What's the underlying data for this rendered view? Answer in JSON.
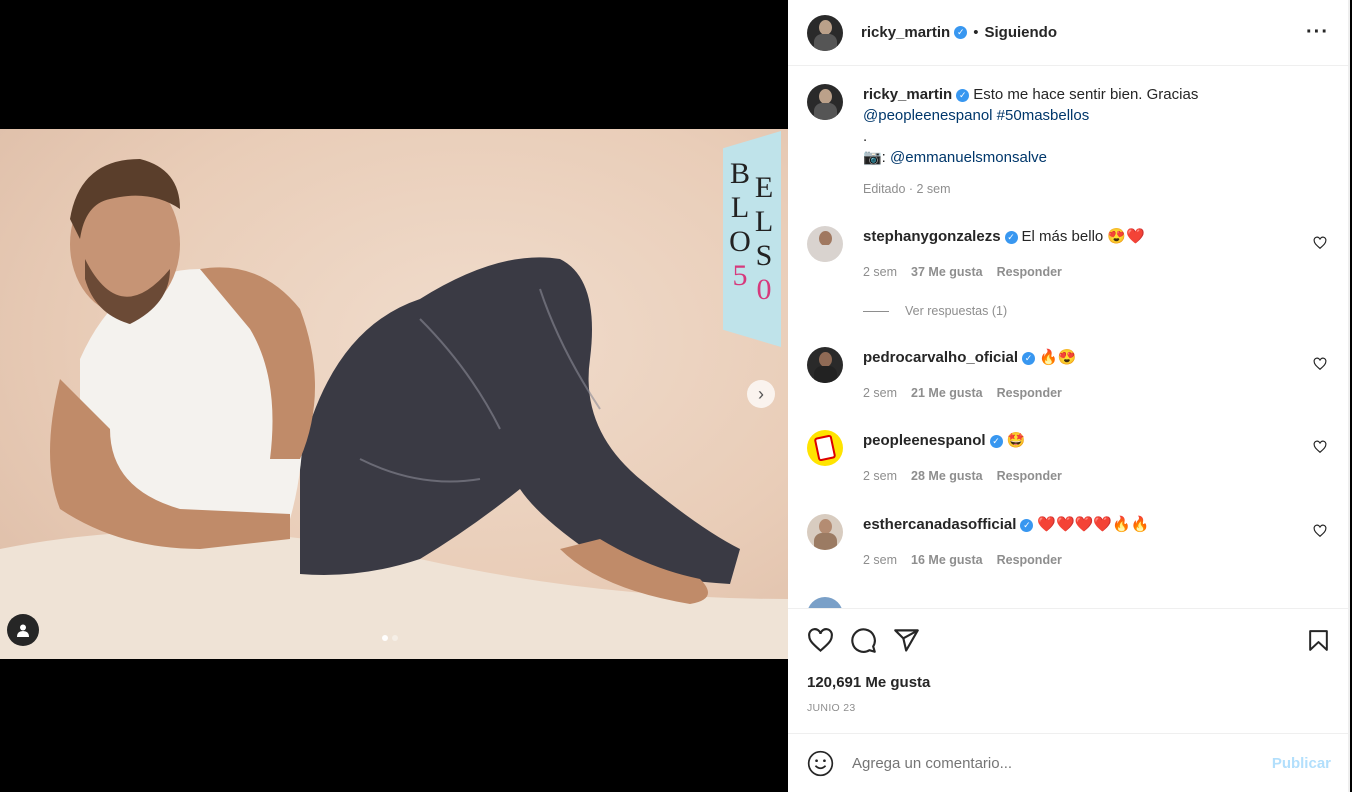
{
  "post": {
    "author": "ricky_martin",
    "follow_state": "Siguiendo",
    "separator": "•",
    "more_label": "•••",
    "banner_top": "B\nL\nO\n5",
    "banner_letters": [
      "B",
      "L",
      "O",
      "5"
    ],
    "banner_letters_right": [
      "E",
      "L",
      "S",
      "0"
    ]
  },
  "caption": {
    "user": "ricky_martin",
    "text": "Esto me hace sentir bien. Gracias",
    "mention1": "@peopleenespanol",
    "hashtag": "#50masbellos",
    "dot": ".",
    "camera": "📷:",
    "mention2": "@emmanuelsmonsalve",
    "meta": "Editado · 2 sem"
  },
  "comments": [
    {
      "user": "stephanygonzalezs",
      "text": "El más bello 😍❤️",
      "time": "2 sem",
      "likes": "37 Me gusta",
      "reply": "Responder",
      "replies": "Ver respuestas (1)"
    },
    {
      "user": "pedrocarvalho_oficial",
      "text": "🔥😍",
      "time": "2 sem",
      "likes": "21 Me gusta",
      "reply": "Responder"
    },
    {
      "user": "peopleenespanol",
      "text": "🤩",
      "time": "2 sem",
      "likes": "28 Me gusta",
      "reply": "Responder"
    },
    {
      "user": "esthercanadasofficial",
      "text": "❤️❤️❤️❤️🔥🔥",
      "time": "2 sem",
      "likes": "16 Me gusta",
      "reply": "Responder"
    }
  ],
  "stats": {
    "likes": "120,691 Me gusta",
    "date": "JUNIO 23"
  },
  "add_comment": {
    "placeholder": "Agrega un comentario...",
    "publish": "Publicar"
  }
}
